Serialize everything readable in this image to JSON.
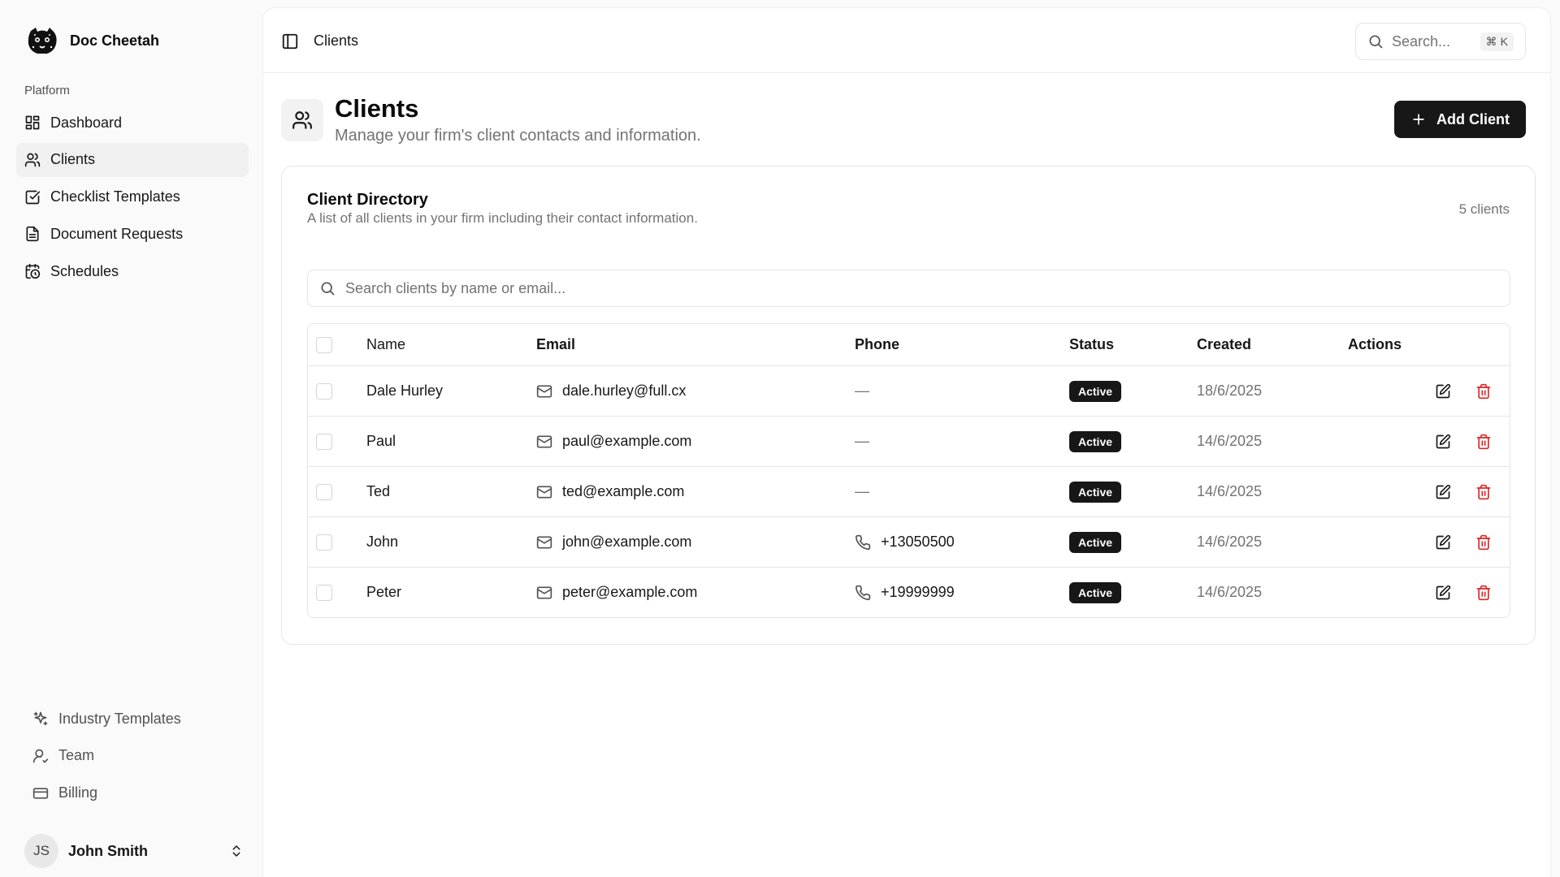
{
  "app": {
    "name": "Doc Cheetah"
  },
  "sidebar": {
    "group_label": "Platform",
    "items": [
      {
        "label": "Dashboard",
        "icon": "dashboard-icon"
      },
      {
        "label": "Clients",
        "icon": "users-icon"
      },
      {
        "label": "Checklist Templates",
        "icon": "checklist-icon"
      },
      {
        "label": "Document Requests",
        "icon": "document-icon"
      },
      {
        "label": "Schedules",
        "icon": "calendar-clock-icon"
      }
    ],
    "active": "Clients",
    "bottom_items": [
      {
        "label": "Industry Templates",
        "icon": "sparkles-icon"
      },
      {
        "label": "Team",
        "icon": "user-icon"
      },
      {
        "label": "Billing",
        "icon": "credit-card-icon"
      }
    ],
    "user": {
      "initials": "JS",
      "name": "John Smith"
    }
  },
  "header": {
    "breadcrumb": "Clients",
    "search_placeholder": "Search...",
    "shortcut_key": "K",
    "shortcut_modifier": "⌘"
  },
  "page": {
    "title": "Clients",
    "subtitle": "Manage your firm's client contacts and information.",
    "add_button": "Add Client"
  },
  "directory": {
    "title": "Client Directory",
    "description": "A list of all clients in your firm including their contact information.",
    "count": "5 clients",
    "search_placeholder": "Search clients by name or email...",
    "columns": {
      "name": "Name",
      "email": "Email",
      "phone": "Phone",
      "status": "Status",
      "created": "Created",
      "actions": "Actions"
    },
    "rows": [
      {
        "name": "Dale Hurley",
        "email": "dale.hurley@full.cx",
        "phone": "—",
        "status": "Active",
        "created": "18/6/2025"
      },
      {
        "name": "Paul",
        "email": "paul@example.com",
        "phone": "—",
        "status": "Active",
        "created": "14/6/2025"
      },
      {
        "name": "Ted",
        "email": "ted@example.com",
        "phone": "—",
        "status": "Active",
        "created": "14/6/2025"
      },
      {
        "name": "John",
        "email": "john@example.com",
        "phone": "+13050500",
        "status": "Active",
        "created": "14/6/2025"
      },
      {
        "name": "Peter",
        "email": "peter@example.com",
        "phone": "+19999999",
        "status": "Active",
        "created": "14/6/2025"
      }
    ]
  },
  "colors": {
    "accent": "#171717",
    "danger": "#dc2626",
    "muted": "#737373"
  }
}
